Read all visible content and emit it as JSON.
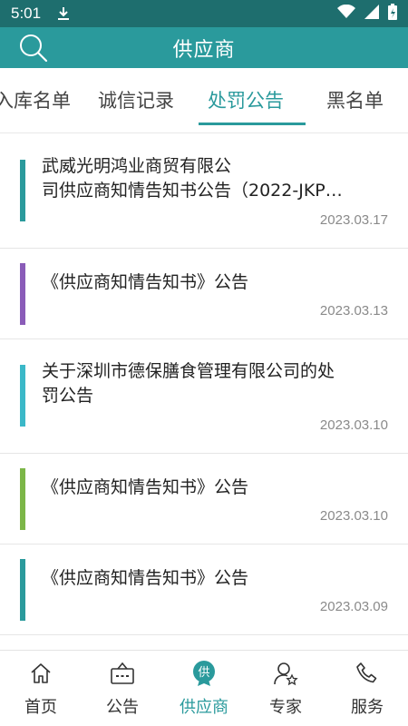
{
  "status_bar": {
    "time": "5:01"
  },
  "header": {
    "title": "供应商"
  },
  "tabs": [
    {
      "label": "入库名单"
    },
    {
      "label": "诚信记录"
    },
    {
      "label": "处罚公告"
    },
    {
      "label": "黑名单"
    }
  ],
  "active_tab": "处罚公告",
  "colors": {
    "primary": "#2a9a9c",
    "status_bar": "#1e6e6e",
    "bar_teal": "#2a9a9c",
    "bar_purple": "#8a5cb8",
    "bar_cyan": "#3bb8c8",
    "bar_green": "#7cb648"
  },
  "notices": [
    {
      "title_line1": "武威光明鸿业商贸有限公",
      "title_line2": "司供应商知情告知书公告（2022-JKP…",
      "date": "2023.03.17",
      "accent": "teal"
    },
    {
      "title_line1": "《供应商知情告知书》公告",
      "title_line2": "",
      "date": "2023.03.13",
      "accent": "purple"
    },
    {
      "title_line1": "关于深圳市德保膳食管理有限公司的处",
      "title_line2": "罚公告",
      "date": "2023.03.10",
      "accent": "cyan"
    },
    {
      "title_line1": "《供应商知情告知书》公告",
      "title_line2": "",
      "date": "2023.03.10",
      "accent": "green"
    },
    {
      "title_line1": "《供应商知情告知书》公告",
      "title_line2": "",
      "date": "2023.03.09",
      "accent": "teal"
    }
  ],
  "bottom_nav": [
    {
      "label": "首页",
      "icon": "home-icon"
    },
    {
      "label": "公告",
      "icon": "notice-board-icon"
    },
    {
      "label": "供应商",
      "icon": "supplier-badge-icon",
      "active": true
    },
    {
      "label": "专家",
      "icon": "expert-user-icon"
    },
    {
      "label": "服务",
      "icon": "phone-icon"
    }
  ]
}
